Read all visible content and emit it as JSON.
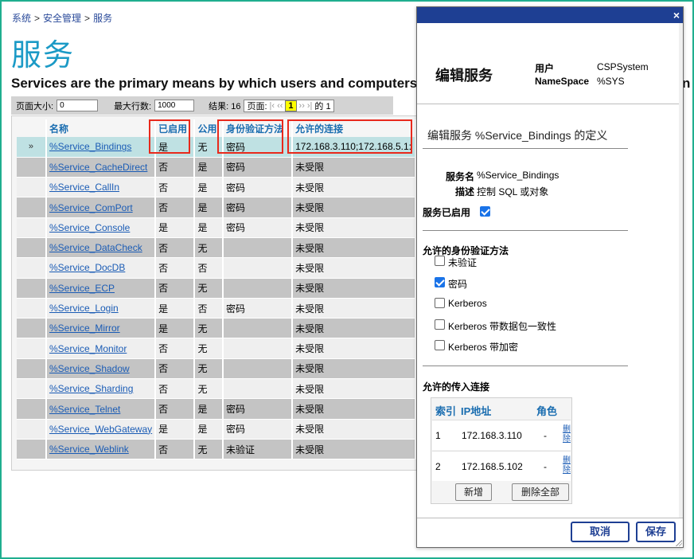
{
  "breadcrumb": [
    "系统",
    "安全管理",
    "服务"
  ],
  "breadcrumb_sep": ">",
  "page_title": "服务",
  "page_description": "Services are the primary means by which users and computers",
  "page_description_tail": "n",
  "pager": {
    "page_size_label": "页面大小:",
    "page_size_value": "0",
    "max_rows_label": "最大行数:",
    "max_rows_value": "1000",
    "results_label": "结果: 16",
    "page_label": "页面:",
    "first": "|‹",
    "prev": "‹‹",
    "current_page": "1",
    "next": "››",
    "last": "›|",
    "of_label": "的 1"
  },
  "table": {
    "columns": [
      "",
      "名称",
      "已启用",
      "公用",
      "身份验证方法",
      "允许的连接"
    ],
    "selected_marker": "»",
    "rows": [
      {
        "name": "%Service_Bindings",
        "enabled": "是",
        "public": "无",
        "auth": "密码",
        "conn": "172.168.3.110;172.168.5.1:"
      },
      {
        "name": "%Service_CacheDirect",
        "enabled": "否",
        "public": "是",
        "auth": "密码",
        "conn": "未受限"
      },
      {
        "name": "%Service_CallIn",
        "enabled": "否",
        "public": "是",
        "auth": "密码",
        "conn": "未受限"
      },
      {
        "name": "%Service_ComPort",
        "enabled": "否",
        "public": "是",
        "auth": "密码",
        "conn": "未受限"
      },
      {
        "name": "%Service_Console",
        "enabled": "是",
        "public": "是",
        "auth": "密码",
        "conn": "未受限"
      },
      {
        "name": "%Service_DataCheck",
        "enabled": "否",
        "public": "无",
        "auth": "",
        "conn": "未受限"
      },
      {
        "name": "%Service_DocDB",
        "enabled": "否",
        "public": "否",
        "auth": "",
        "conn": "未受限"
      },
      {
        "name": "%Service_ECP",
        "enabled": "否",
        "public": "无",
        "auth": "",
        "conn": "未受限"
      },
      {
        "name": "%Service_Login",
        "enabled": "是",
        "public": "否",
        "auth": "密码",
        "conn": "未受限"
      },
      {
        "name": "%Service_Mirror",
        "enabled": "是",
        "public": "无",
        "auth": "",
        "conn": "未受限"
      },
      {
        "name": "%Service_Monitor",
        "enabled": "否",
        "public": "无",
        "auth": "",
        "conn": "未受限"
      },
      {
        "name": "%Service_Shadow",
        "enabled": "否",
        "public": "无",
        "auth": "",
        "conn": "未受限"
      },
      {
        "name": "%Service_Sharding",
        "enabled": "否",
        "public": "无",
        "auth": "",
        "conn": "未受限"
      },
      {
        "name": "%Service_Telnet",
        "enabled": "否",
        "public": "是",
        "auth": "密码",
        "conn": "未受限"
      },
      {
        "name": "%Service_WebGateway",
        "enabled": "是",
        "public": "是",
        "auth": "密码",
        "conn": "未受限"
      },
      {
        "name": "%Service_Weblink",
        "enabled": "否",
        "public": "无",
        "auth": "未验证",
        "conn": "未受限"
      }
    ]
  },
  "modal": {
    "close": "×",
    "title": "编辑服务",
    "user_label": "用户",
    "user_value": "CSPSystem",
    "namespace_label": "NameSpace",
    "namespace_value": "%SYS",
    "definition_title": "编辑服务 %Service_Bindings 的定义",
    "service_name_label": "服务名",
    "service_name_value": "%Service_Bindings",
    "description_label": "描述",
    "description_value": "控制 SQL 或对象",
    "enabled_label": "服务已启用",
    "enabled_checked": true,
    "auth_section_title": "允许的身份验证方法",
    "auth_options": [
      {
        "label": "未验证",
        "checked": false
      },
      {
        "label": "密码",
        "checked": true
      },
      {
        "label": "Kerberos",
        "checked": false
      },
      {
        "label": "Kerberos 带数据包一致性",
        "checked": false
      },
      {
        "label": "Kerberos 带加密",
        "checked": false
      }
    ],
    "conn_section_title": "允许的传入连接",
    "conn_headers": {
      "index": "索引",
      "ip": "IP地址",
      "role": "角色"
    },
    "connections": [
      {
        "index": "1",
        "ip": "172.168.3.110",
        "role": "-",
        "delete": "删除"
      },
      {
        "index": "2",
        "ip": "172.168.5.102",
        "role": "-",
        "delete": "删除"
      }
    ],
    "add_button": "新增",
    "delete_all_button": "删除全部",
    "cancel_button": "取消",
    "save_button": "保存"
  }
}
